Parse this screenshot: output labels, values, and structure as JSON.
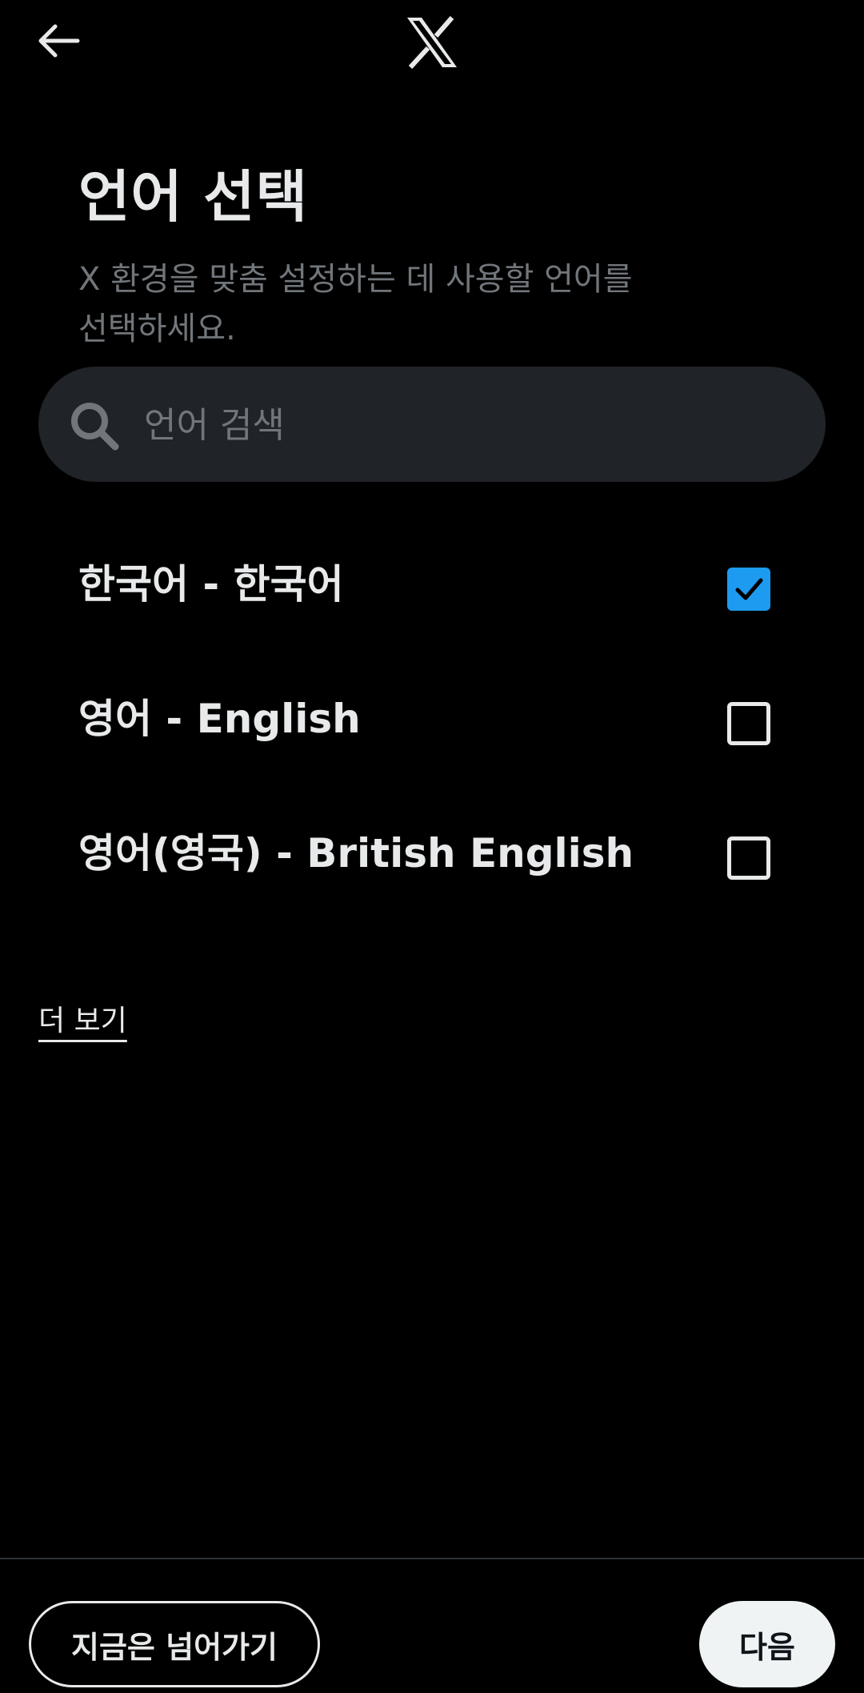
{
  "header": {
    "back_icon": "arrow-left-icon",
    "logo_icon": "x-logo-icon"
  },
  "page": {
    "title": "언어 선택",
    "subtitle": "X 환경을 맞춤 설정하는 데 사용할 언어를 선택하세요."
  },
  "search": {
    "placeholder": "언어 검색",
    "value": "",
    "icon": "search-icon"
  },
  "languages": [
    {
      "label": "한국어 - 한국어",
      "checked": true
    },
    {
      "label": "영어 - English",
      "checked": false
    },
    {
      "label": "영어(영국) - British English",
      "checked": false
    }
  ],
  "more_link": "더 보기",
  "footer": {
    "skip_label": "지금은 넘어가기",
    "next_label": "다음"
  },
  "colors": {
    "background": "#000000",
    "text_primary": "#e7e9ea",
    "text_secondary": "#71767b",
    "accent": "#1d9bf0",
    "search_bg": "#202327"
  }
}
